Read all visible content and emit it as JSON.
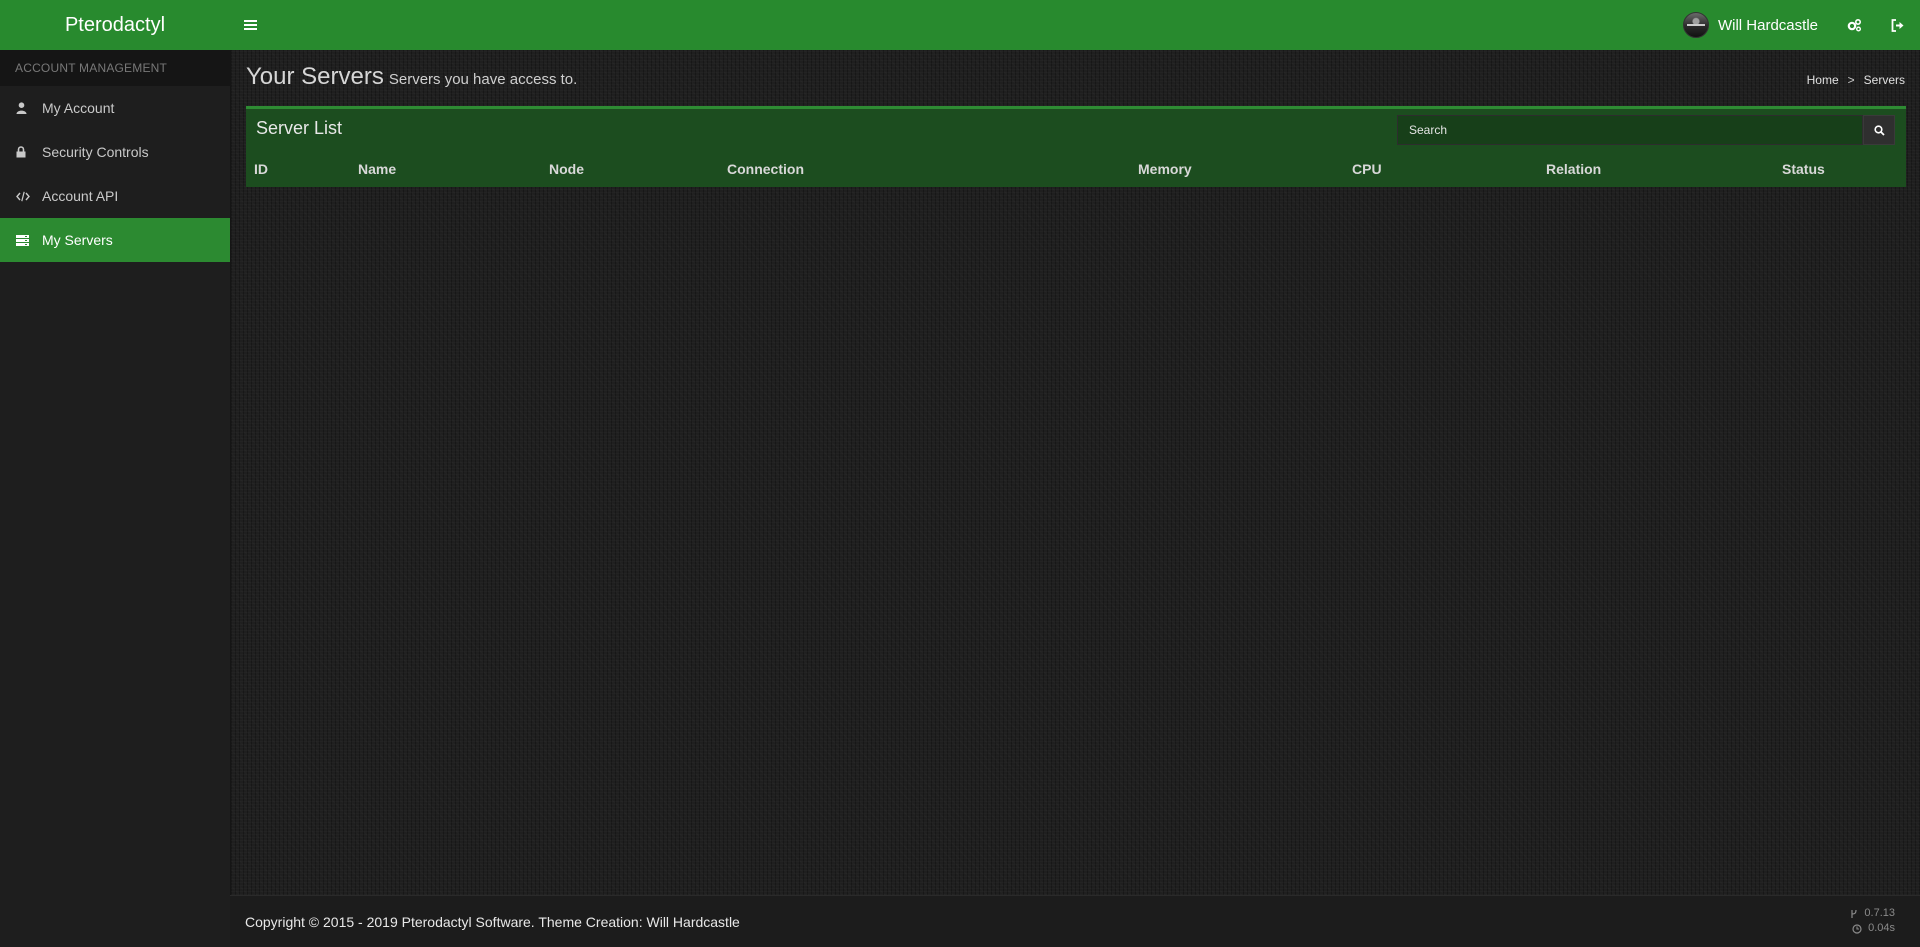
{
  "app": {
    "brand": "Pterodactyl"
  },
  "topbar": {
    "menu_icon": "hamburger-icon",
    "user_name": "Will Hardcastle",
    "settings_icon": "cogs-icon",
    "logout_icon": "sign-out-icon"
  },
  "sidebar": {
    "header": "ACCOUNT MANAGEMENT",
    "items": [
      {
        "label": "My Account",
        "icon": "user-icon",
        "active": false
      },
      {
        "label": "Security Controls",
        "icon": "lock-icon",
        "active": false
      },
      {
        "label": "Account API",
        "icon": "code-icon",
        "active": false
      },
      {
        "label": "My Servers",
        "icon": "server-icon",
        "active": true
      }
    ]
  },
  "page": {
    "title": "Your Servers",
    "subtitle": "Servers you have access to.",
    "breadcrumb": {
      "home": "Home",
      "separator": ">",
      "current": "Servers"
    }
  },
  "server_list": {
    "title": "Server List",
    "search_placeholder": "Search",
    "columns": [
      "ID",
      "Name",
      "Node",
      "Connection",
      "Memory",
      "CPU",
      "Relation",
      "Status"
    ],
    "rows": []
  },
  "footer": {
    "copyright": "Copyright © 2015 - 2019 Pterodactyl Software. Theme Creation: Will Hardcastle",
    "version": "0.7.13",
    "render_time": "0.04s"
  },
  "colors": {
    "accent": "#288a2e",
    "box_bg": "#1c4d1f",
    "sidebar_bg": "#1e1e1e"
  }
}
